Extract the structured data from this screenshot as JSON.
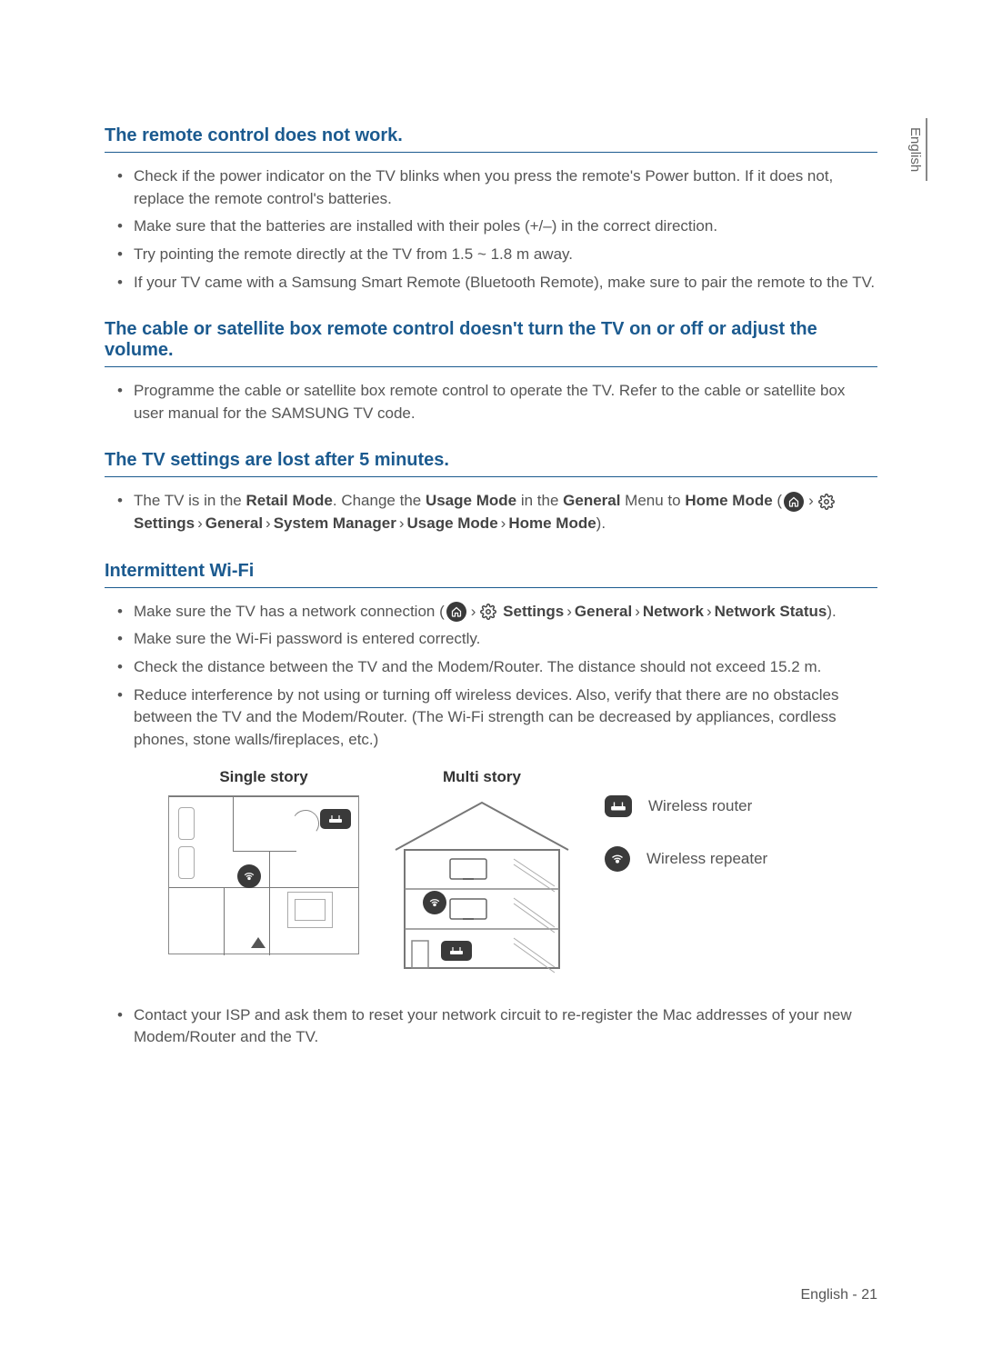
{
  "sideTab": "English",
  "sections": {
    "remote": {
      "heading": "The remote control does not work.",
      "items": [
        "Check if the power indicator on the TV blinks when you press the remote's Power button. If it does not, replace the remote control's batteries.",
        "Make sure that the batteries are installed with their poles (+/–) in the correct direction.",
        "Try pointing the remote directly at the TV from 1.5 ~ 1.8 m away.",
        "If your TV came with a Samsung Smart Remote (Bluetooth Remote), make sure to pair the remote to the TV."
      ]
    },
    "cable": {
      "heading": "The cable or satellite box remote control doesn't turn the TV on or off or adjust the volume.",
      "items": [
        "Programme the cable or satellite box remote control to operate the TV. Refer to the cable or satellite box user manual for the SAMSUNG TV code."
      ]
    },
    "settingsLost": {
      "heading": "The TV settings are lost after 5 minutes.",
      "bullet_prefix": "The TV is in the ",
      "retailMode": "Retail Mode",
      "changeText": ". Change the ",
      "usageMode": "Usage Mode",
      "inThe": " in the ",
      "general": "General",
      "menuTo": " Menu to ",
      "homeMode": "Home Mode",
      "path": {
        "settings": "Settings",
        "general": "General",
        "systemManager": "System Manager",
        "usageMode": "Usage Mode",
        "homeMode": "Home Mode"
      }
    },
    "wifi": {
      "heading": "Intermittent Wi-Fi",
      "item1_prefix": "Make sure the TV has a network connection (",
      "path": {
        "settings": "Settings",
        "general": "General",
        "network": "Network",
        "networkStatus": "Network Status"
      },
      "items_rest": [
        "Make sure the Wi-Fi password is entered correctly.",
        "Check the distance between the TV and the Modem/Router. The distance should not exceed 15.2 m.",
        "Reduce interference by not using or turning off wireless devices. Also, verify that there are no obstacles between the TV and the Modem/Router. (The Wi-Fi strength can be decreased by appliances, cordless phones, stone walls/fireplaces, etc.)"
      ],
      "diagram_single": "Single story",
      "diagram_multi": "Multi story",
      "legend_router": "Wireless router",
      "legend_repeater": "Wireless repeater",
      "after_item": "Contact your ISP and ask them to reset your network circuit to re-register the Mac addresses of your new Modem/Router and the TV."
    }
  },
  "footer": {
    "lang": "English",
    "sep": " - ",
    "page": "21"
  },
  "glyphs": {
    "chevron": "›",
    "openParen": " (",
    "closeParen": ").",
    "closeParen2": ")."
  }
}
